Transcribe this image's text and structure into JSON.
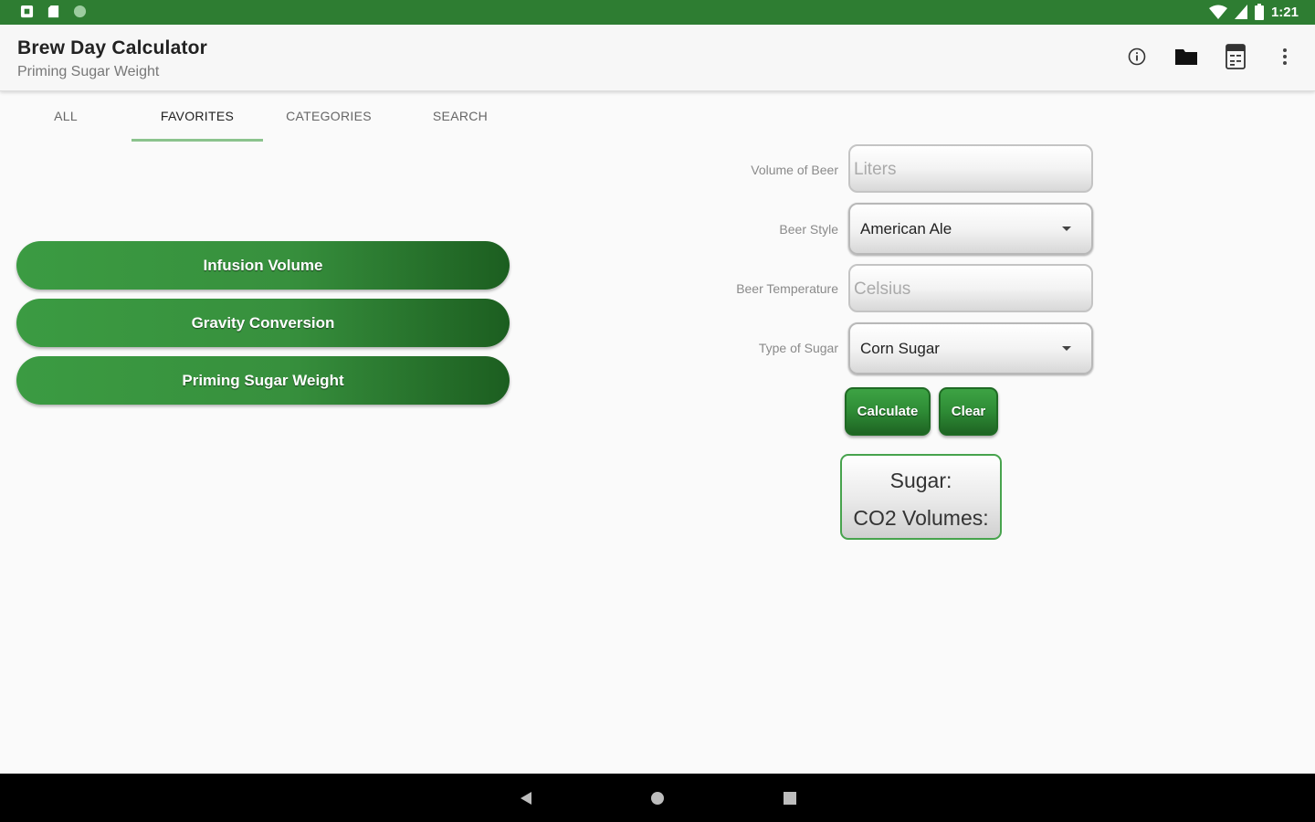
{
  "status_bar": {
    "time": "1:21",
    "icons": [
      "app-notification-icon",
      "sd-card-icon",
      "circle-icon",
      "wifi-icon",
      "signal-icon",
      "battery-icon"
    ]
  },
  "app_bar": {
    "title": "Brew Day Calculator",
    "subtitle": "Priming Sugar Weight",
    "actions": [
      "info-icon",
      "folder-icon",
      "calculator-icon",
      "more-vert-icon"
    ]
  },
  "tabs": [
    {
      "label": "ALL",
      "active": false
    },
    {
      "label": "FAVORITES",
      "active": true
    },
    {
      "label": "CATEGORIES",
      "active": false
    },
    {
      "label": "SEARCH",
      "active": false
    }
  ],
  "favorites": [
    {
      "label": "Infusion Volume"
    },
    {
      "label": "Gravity Conversion"
    },
    {
      "label": "Priming Sugar Weight"
    }
  ],
  "form": {
    "volume": {
      "label": "Volume of Beer",
      "placeholder": "Liters",
      "value": ""
    },
    "style": {
      "label": "Beer Style",
      "value": "American Ale"
    },
    "temperature": {
      "label": "Beer Temperature",
      "placeholder": "Celsius",
      "value": ""
    },
    "sugar": {
      "label": "Type of Sugar",
      "value": "Corn Sugar"
    },
    "calculate_label": "Calculate",
    "clear_label": "Clear"
  },
  "result": {
    "sugar": "Sugar:",
    "co2": "CO2 Volumes:"
  },
  "colors": {
    "primary": "#2e7d32",
    "accent": "#8bc38d",
    "button_start": "#3b9b42",
    "button_end": "#1c5e20"
  },
  "nav_bar": [
    "back-icon",
    "home-icon",
    "recents-icon"
  ]
}
